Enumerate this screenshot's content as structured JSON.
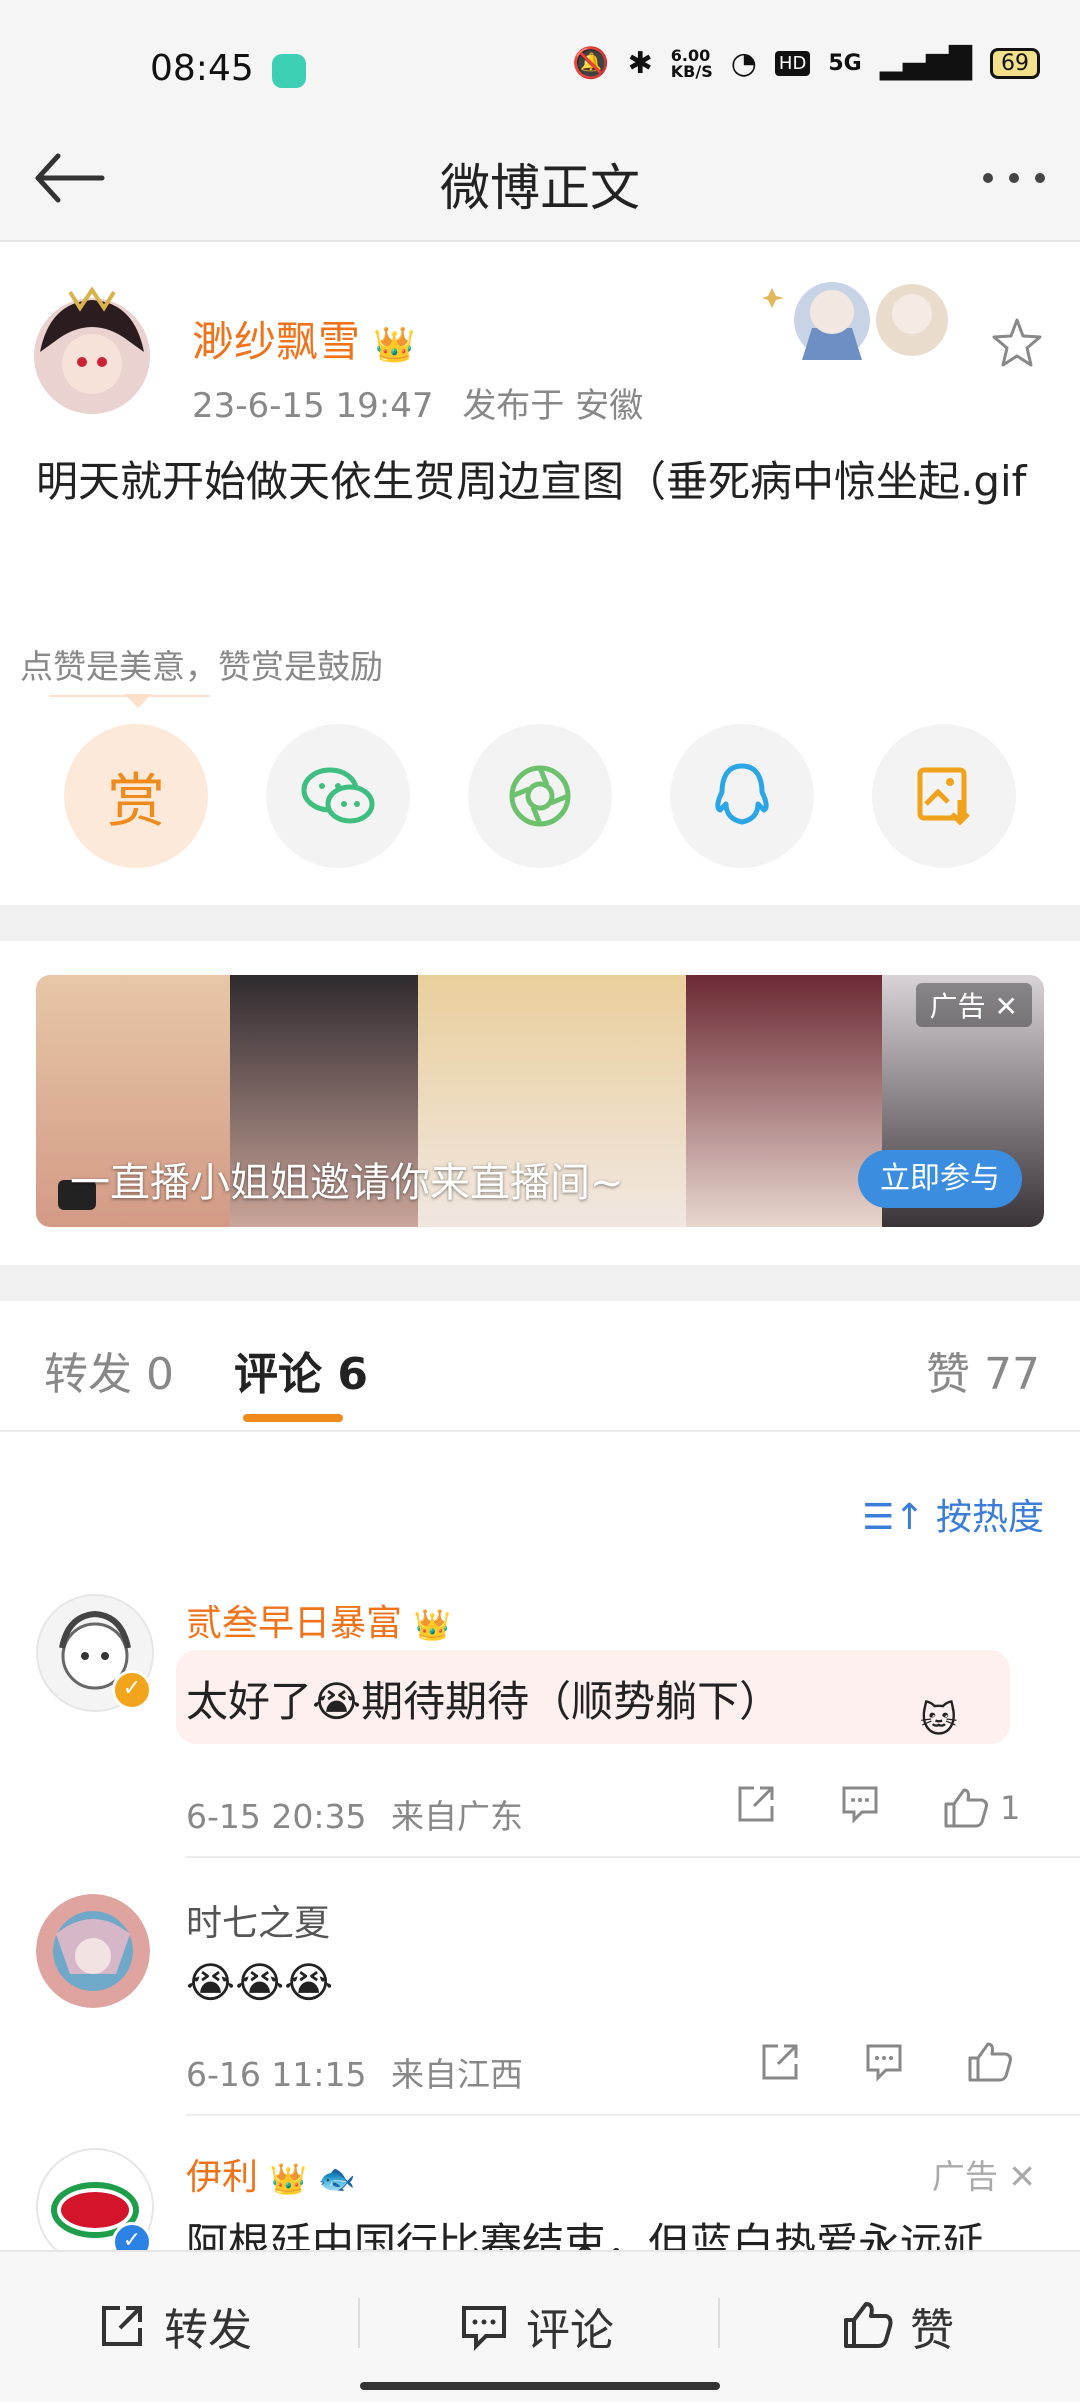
{
  "status": {
    "time": "08:45",
    "net_speed": "6.00\nKB/S",
    "battery": "69",
    "signal": "5G",
    "hd": "HD"
  },
  "nav": {
    "title": "微博正文"
  },
  "post": {
    "author": "渺纱飘雪",
    "time": "23-6-15 19:47",
    "location": "发布于 安徽",
    "text": "明天就开始做天依生贺周边宣图（垂死病中惊坐起.gif",
    "hint": "点赞是美意，赞赏是鼓励",
    "share": [
      {
        "name": "赏",
        "icon": "reward-icon",
        "color": "#f08a1b"
      },
      {
        "name": "wechat",
        "icon": "wechat-icon",
        "color": "#3fbf7f"
      },
      {
        "name": "moments",
        "icon": "moments-icon",
        "color": "#6cc26c"
      },
      {
        "name": "qq",
        "icon": "qq-icon",
        "color": "#2aa6e8"
      },
      {
        "name": "save-image",
        "icon": "save-image-icon",
        "color": "#f0a21b"
      }
    ]
  },
  "ad_banner": {
    "text": "一直播小姐姐邀请你来直播间~",
    "cta": "立即参与",
    "tag": "广告 ✕"
  },
  "tabs": {
    "repost": "转发 0",
    "comment": "评论 6",
    "like": "赞 77",
    "sort": "按热度"
  },
  "comments": [
    {
      "name": "贰叁早日暴富",
      "text": "太好了😭期待期待（顺势躺下）",
      "time": "6-15 20:35",
      "location": "来自广东",
      "likes": "1",
      "name_color": "#f0731b"
    },
    {
      "name": "时七之夏",
      "text": "😭😭😭",
      "time": "6-16 11:15",
      "location": "来自江西",
      "likes": "",
      "name_color": "#555555"
    },
    {
      "name": "伊利",
      "text": "阿根廷中国行比赛结束，但蓝白热爱永远延",
      "ad_tag": "广告 ✕",
      "name_color": "#f0731b"
    }
  ],
  "bottom": {
    "repost": "转发",
    "comment": "评论",
    "like": "赞"
  },
  "colors": {
    "accent": "#f0731b",
    "link": "#3b7dd8",
    "cta": "#3b8de0"
  }
}
